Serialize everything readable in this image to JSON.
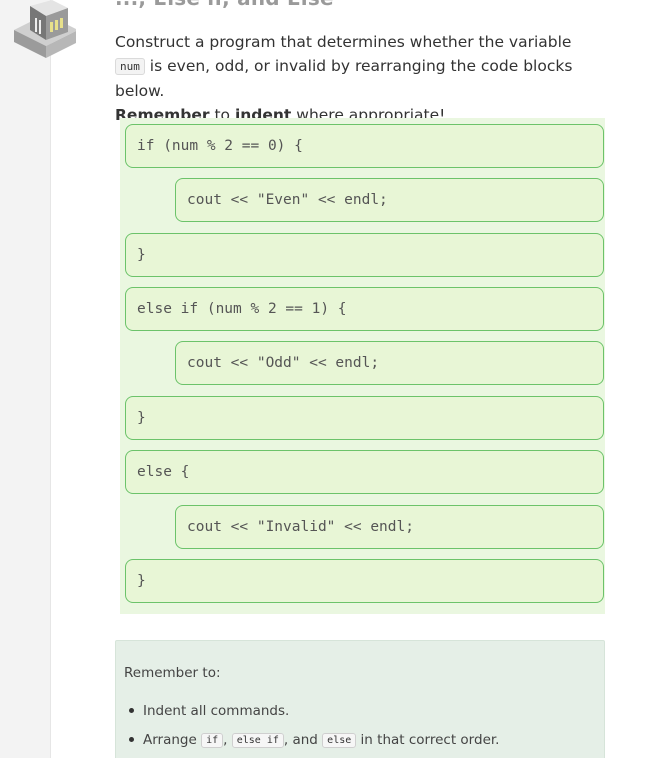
{
  "header": {
    "title_fragment": "..., Else if, and Else"
  },
  "intro": {
    "part1": "Construct a program that determines whether the variable ",
    "variable": "num",
    "part2": " is even, odd, or invalid by rearranging the code blocks below.",
    "remember": "Remember",
    "to": " to ",
    "indent": "indent",
    "rest": " where appropriate!"
  },
  "code_blocks": [
    {
      "text": "if (num % 2 == 0) {",
      "indent": 0
    },
    {
      "text": "cout << \"Even\" << endl;",
      "indent": 1
    },
    {
      "text": "}",
      "indent": 0
    },
    {
      "text": "else if (num % 2 == 1) {",
      "indent": 0
    },
    {
      "text": "cout << \"Odd\" << endl;",
      "indent": 1
    },
    {
      "text": "}",
      "indent": 0
    },
    {
      "text": "else {",
      "indent": 0
    },
    {
      "text": "cout << \"Invalid\" << endl;",
      "indent": 1
    },
    {
      "text": "}",
      "indent": 0
    }
  ],
  "note": {
    "title": "Remember to:",
    "item1": "Indent all commands.",
    "item2_part1": "Arrange ",
    "item2_code1": "if",
    "item2_sep1": ", ",
    "item2_code2": "else if",
    "item2_sep2": ", and ",
    "item2_code3": "else",
    "item2_part2": " in that correct order."
  },
  "colors": {
    "block_border": "#6cc36a",
    "block_fill": "#e8f6d6",
    "area_fill": "#eaf7e0",
    "note_fill": "#e5efe7"
  },
  "icons": {
    "logo": "codio-isometric-logo-icon"
  }
}
